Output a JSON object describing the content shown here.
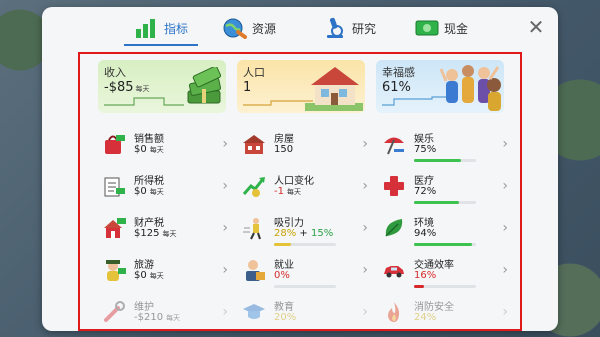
{
  "tabs": [
    {
      "label": "指标",
      "icon": "bar-chart-icon",
      "active": true
    },
    {
      "label": "资源",
      "icon": "globe-resources-icon",
      "active": false
    },
    {
      "label": "研究",
      "icon": "microscope-icon",
      "active": false
    },
    {
      "label": "现金",
      "icon": "cash-icon",
      "active": false
    }
  ],
  "close_label": "✕",
  "cards": {
    "income": {
      "title": "收入",
      "value": "-$85",
      "unit": "每天"
    },
    "population": {
      "title": "人口",
      "value": "1"
    },
    "happiness": {
      "title": "幸福感",
      "value": "61%"
    }
  },
  "columns": {
    "left": [
      {
        "label": "销售额",
        "value": "$0",
        "unit": "每天",
        "icon": "shopping-bag-icon"
      },
      {
        "label": "所得税",
        "value": "$0",
        "unit": "每天",
        "icon": "tax-document-icon"
      },
      {
        "label": "财产税",
        "value": "$125",
        "unit": "每天",
        "icon": "property-tax-icon"
      },
      {
        "label": "旅游",
        "value": "$0",
        "unit": "每天",
        "icon": "tourist-icon"
      },
      {
        "label": "维护",
        "value": "-$210",
        "unit": "每天",
        "icon": "wrench-icon"
      }
    ],
    "middle": [
      {
        "label": "房屋",
        "value": "150",
        "icon": "house-icon"
      },
      {
        "label": "人口变化",
        "value": "-1",
        "unit": "每天",
        "icon": "population-change-icon"
      },
      {
        "label": "吸引力",
        "value_a": "28%",
        "plus": "+",
        "value_b": "15%",
        "icon": "attraction-icon"
      },
      {
        "label": "就业",
        "value": "0%",
        "icon": "employment-icon"
      },
      {
        "label": "教育",
        "value": "20%",
        "icon": "education-icon"
      }
    ],
    "right": [
      {
        "label": "娱乐",
        "value": "75%",
        "icon": "beach-umbrella-icon",
        "progress": 0.75
      },
      {
        "label": "医疗",
        "value": "72%",
        "icon": "medical-cross-icon",
        "progress": 0.72
      },
      {
        "label": "环境",
        "value": "94%",
        "icon": "leaf-icon",
        "progress": 0.94
      },
      {
        "label": "交通效率",
        "value": "16%",
        "icon": "car-icon",
        "progress": 0.16
      },
      {
        "label": "消防安全",
        "value": "24%",
        "icon": "fire-icon",
        "progress": 0.24
      }
    ]
  },
  "colors": {
    "accent": "#2e74c6",
    "positive": "#3cc24e",
    "negative": "#d62a2a",
    "warning": "#c9a300",
    "highlight_border": "#e0191b"
  }
}
